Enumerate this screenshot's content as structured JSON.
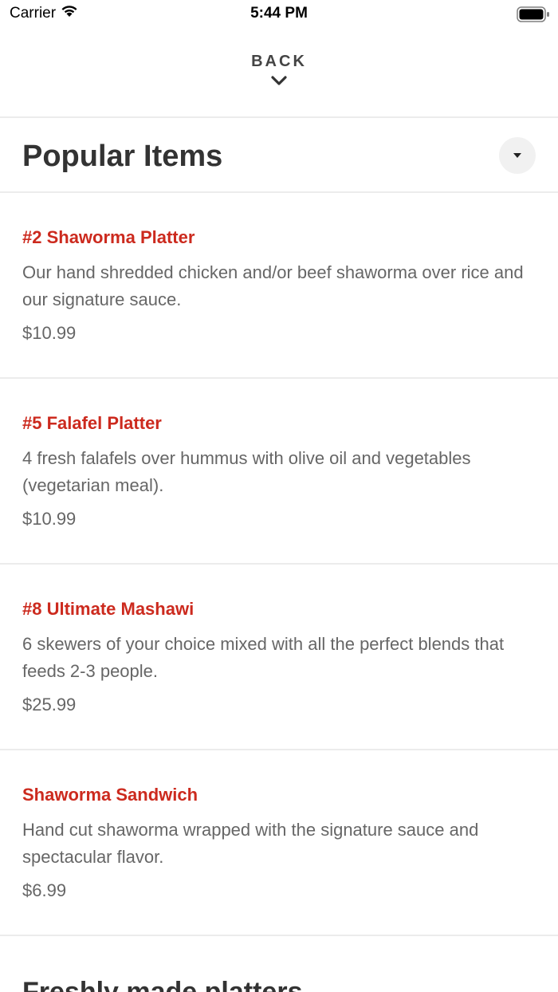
{
  "status_bar": {
    "carrier": "Carrier",
    "time": "5:44 PM",
    "wifi_icon": "wifi-icon",
    "battery_icon": "battery-icon"
  },
  "nav": {
    "back_label": "BACK",
    "back_icon": "chevron-down-icon"
  },
  "section": {
    "title": "Popular Items",
    "dropdown_icon": "caret-down-icon"
  },
  "items": [
    {
      "name": "#2 Shaworma Platter",
      "description": "Our hand shredded chicken and/or beef shaworma over rice and our signature sauce.",
      "price": "$10.99"
    },
    {
      "name": "#5 Falafel Platter",
      "description": "4 fresh falafels over hummus with olive oil and vegetables (vegetarian meal).",
      "price": "$10.99"
    },
    {
      "name": "#8 Ultimate Mashawi",
      "description": "6 skewers of your choice mixed with all the perfect blends that feeds 2-3 people.",
      "price": "$25.99"
    },
    {
      "name": "Shaworma Sandwich",
      "description": "Hand cut shaworma wrapped with the signature sauce and spectacular flavor.",
      "price": "$6.99"
    }
  ],
  "next_section": {
    "title": "Freshly made platters"
  },
  "colors": {
    "item_name": "#cc2a1e",
    "text_secondary": "#666666",
    "heading": "#333333"
  }
}
